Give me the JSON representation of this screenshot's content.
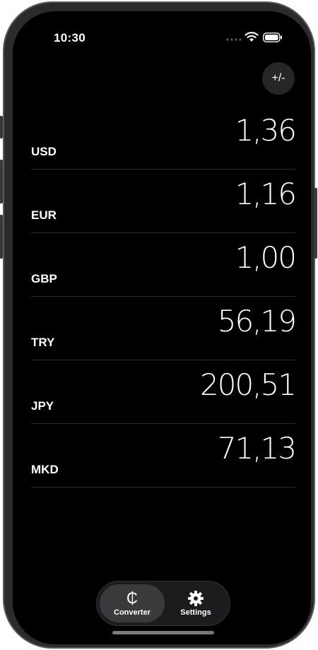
{
  "status_bar": {
    "time": "10:30"
  },
  "toolbar": {
    "sign_toggle_label": "+/-"
  },
  "currencies": [
    {
      "code": "USD",
      "value": "1,36"
    },
    {
      "code": "EUR",
      "value": "1,16"
    },
    {
      "code": "GBP",
      "value": "1,00"
    },
    {
      "code": "TRY",
      "value": "56,19"
    },
    {
      "code": "JPY",
      "value": "200,51"
    },
    {
      "code": "MKD",
      "value": "71,13"
    }
  ],
  "tab_bar": {
    "tabs": [
      {
        "label": "Converter",
        "icon": "currency-sign-icon",
        "glyph": "₵",
        "selected": true
      },
      {
        "label": "Settings",
        "icon": "gear-icon",
        "selected": false
      }
    ]
  },
  "colors": {
    "background": "#000000",
    "text": "#ffffff",
    "divider": "#2c2c2e",
    "selected_tab": "#3a3a3c",
    "tab_bar": "#1c1c1e"
  }
}
